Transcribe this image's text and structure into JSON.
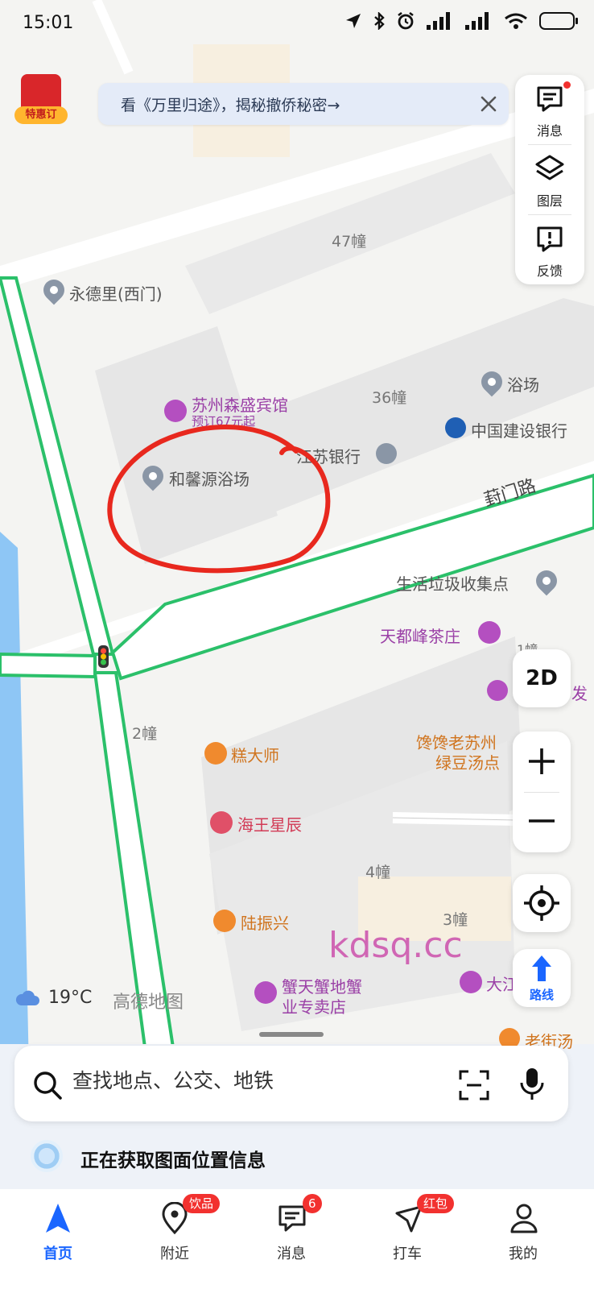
{
  "status_bar": {
    "time": "15:01"
  },
  "promo": {
    "tag": "特惠订"
  },
  "banner": {
    "text": "看《万里归途》，揭秘撤侨秘密→"
  },
  "side_panel": {
    "messages_label": "消息",
    "layers_label": "图层",
    "feedback_label": "反馈"
  },
  "map": {
    "buildings": [
      "47幢",
      "36幢",
      "2幢",
      "4幢",
      "3幢",
      "1幢"
    ],
    "road": "葑门路",
    "pois": {
      "yongdeli": "永德里(西门)",
      "bathhouse": "浴场",
      "sensheng_hotel": "苏州森盛宾馆",
      "sensheng_price": "预订67元起",
      "ccb": "中国建设银行",
      "jsbank": "江苏银行",
      "hexinyuan": "和馨源浴场",
      "garbage": "生活垃圾收集点",
      "teahouse": "天都峰茶庄",
      "hair": "发",
      "gaodashi": "糕大师",
      "lvdou_1": "馋馋老苏州",
      "lvdou_2": "绿豆汤点",
      "haiwang": "海王星辰",
      "luzhenxing": "陆振兴",
      "xietian_1": "蟹天蟹地蟹",
      "xietian_2": "业专卖店",
      "dajiang": "大江",
      "laojie": "老街汤"
    },
    "weather": "19°C",
    "map_brand": "高德地图",
    "watermark": "kdsq.cc"
  },
  "controls": {
    "mode_2d": "2D",
    "route_label": "路线"
  },
  "search": {
    "placeholder": "查找地点、公交、地铁"
  },
  "location_status": "正在获取图面位置信息",
  "tabs": [
    {
      "label": "首页"
    },
    {
      "label": "附近",
      "badge": "饮品"
    },
    {
      "label": "消息",
      "badge": "6"
    },
    {
      "label": "打车",
      "badge": "红包"
    },
    {
      "label": "我的"
    }
  ],
  "colors": {
    "accent": "#1a66ff",
    "road_outline": "#2bc06a",
    "annotation": "#e8281e"
  }
}
